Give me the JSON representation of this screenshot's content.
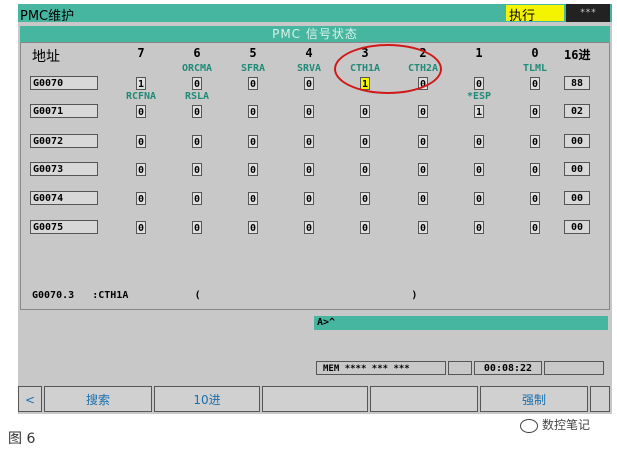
{
  "titlebar": {
    "left": "PMC维护",
    "mode": "执行",
    "stars": "***"
  },
  "panel_title": "PMC 信号状态",
  "header": {
    "addr_label": "地址",
    "bits": [
      "7",
      "6",
      "5",
      "4",
      "3",
      "2",
      "1",
      "0"
    ],
    "hex_label": "16进"
  },
  "rows": [
    {
      "addr": "G0070",
      "signals": [
        "",
        "ORCMA",
        "SFRA",
        "SRVA",
        "CTH1A",
        "CTH2A",
        "",
        "TLML"
      ],
      "bits": [
        "1",
        "0",
        "0",
        "0",
        "1",
        "0",
        "0",
        "0"
      ],
      "hex": "88",
      "highlight": 4
    },
    {
      "addr": "G0071",
      "signals": [
        "RCFNA",
        "RSLA",
        "",
        "",
        "",
        "",
        "*ESP",
        ""
      ],
      "bits": [
        "0",
        "0",
        "0",
        "0",
        "0",
        "0",
        "1",
        "0"
      ],
      "hex": "02"
    },
    {
      "addr": "G0072",
      "signals": [
        "",
        "",
        "",
        "",
        "",
        "",
        "",
        ""
      ],
      "bits": [
        "0",
        "0",
        "0",
        "0",
        "0",
        "0",
        "0",
        "0"
      ],
      "hex": "00"
    },
    {
      "addr": "G0073",
      "signals": [
        "",
        "",
        "",
        "",
        "",
        "",
        "",
        ""
      ],
      "bits": [
        "0",
        "0",
        "0",
        "0",
        "0",
        "0",
        "0",
        "0"
      ],
      "hex": "00"
    },
    {
      "addr": "G0074",
      "signals": [
        "",
        "",
        "",
        "",
        "",
        "",
        "",
        ""
      ],
      "bits": [
        "0",
        "0",
        "0",
        "0",
        "0",
        "0",
        "0",
        "0"
      ],
      "hex": "00"
    },
    {
      "addr": "G0075",
      "signals": [
        "",
        "",
        "",
        "",
        "",
        "",
        "",
        ""
      ],
      "bits": [
        "0",
        "0",
        "0",
        "0",
        "0",
        "0",
        "0",
        "0"
      ],
      "hex": "00"
    }
  ],
  "status": {
    "addr": "G0070.3",
    "name": ":CTH1A",
    "open": "(",
    "close": ")"
  },
  "input": {
    "prompt": "A>^"
  },
  "mem": {
    "label": "MEM",
    "stars": "**** *** ***"
  },
  "time": "00:08:22",
  "softkeys": [
    "<",
    "搜索",
    "10进",
    "",
    "",
    "强制",
    ""
  ],
  "caption": "图 6",
  "watermark": "数控笔记",
  "colors": {
    "accent": "#47b6a0",
    "highlight": "#f4f400",
    "annotation": "#d01818"
  }
}
